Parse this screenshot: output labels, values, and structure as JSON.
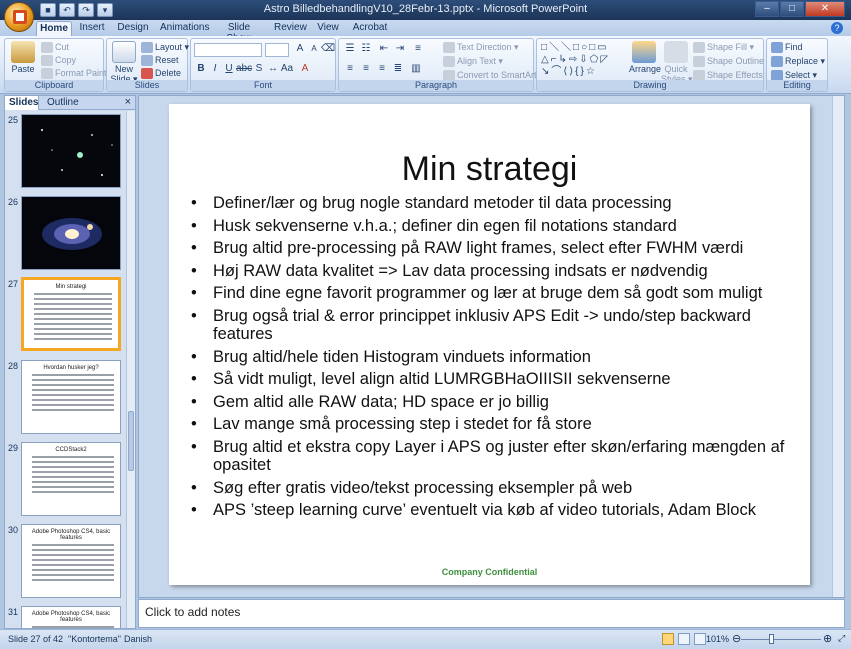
{
  "window": {
    "title": "Astro BilledbehandlingV10_28Febr-13.pptx - Microsoft PowerPoint"
  },
  "ribbon_tabs": [
    "Home",
    "Insert",
    "Design",
    "Animations",
    "Slide Show",
    "Review",
    "View",
    "Acrobat"
  ],
  "ribbon": {
    "clipboard": {
      "label": "Clipboard",
      "paste": "Paste",
      "cut": "Cut",
      "copy": "Copy",
      "format_painter": "Format Painter"
    },
    "slides": {
      "label": "Slides",
      "new_slide_1": "New",
      "new_slide_2": "Slide ▾",
      "layout": "Layout ▾",
      "reset": "Reset",
      "delete": "Delete"
    },
    "font": {
      "label": "Font"
    },
    "paragraph": {
      "label": "Paragraph",
      "text_direction": "Text Direction ▾",
      "align_text": "Align Text ▾",
      "convert_smartart": "Convert to SmartArt ▾"
    },
    "drawing": {
      "label": "Drawing",
      "arrange": "Arrange",
      "quick_styles_1": "Quick",
      "quick_styles_2": "Styles ▾",
      "shape_fill": "Shape Fill ▾",
      "shape_outline": "Shape Outline ▾",
      "shape_effects": "Shape Effects ▾"
    },
    "editing": {
      "label": "Editing",
      "find": "Find",
      "replace": "Replace ▾",
      "select": "Select ▾"
    }
  },
  "left_pane": {
    "tab_slides": "Slides",
    "tab_outline": "Outline",
    "thumbnails": [
      {
        "number": "25",
        "kind": "starfield"
      },
      {
        "number": "26",
        "kind": "galaxy"
      },
      {
        "number": "27",
        "title": "Min strategi",
        "selected": true
      },
      {
        "number": "28",
        "title": "Hvordan husker jeg?"
      },
      {
        "number": "29",
        "title": "CCDStack2"
      },
      {
        "number": "30",
        "title": "Adobe Photoshop CS4, basic features"
      },
      {
        "number": "31",
        "title": "Adobe Photoshop CS4, basic features"
      }
    ]
  },
  "slide": {
    "title": "Min strategi",
    "bullets": [
      "Definer/lær og brug nogle standard metoder til data processing",
      "Husk sekvenserne v.h.a.; definer din egen fil notations standard",
      "Brug altid pre-processing på RAW light frames, select efter FWHM værdi",
      "Høj RAW data kvalitet => Lav data processing indsats er nødvendig",
      "Find dine egne favorit programmer og lær at bruge dem så godt som muligt",
      "Brug også trial & error princippet inklusiv APS Edit -> undo/step backward features",
      "Brug altid/hele tiden Histogram vinduets information",
      "Så vidt muligt, level align altid LUMRGBHaOIIISII sekvenserne",
      "Gem altid alle RAW data; HD space er jo billig",
      "Lav mange små processing step i stedet for få store",
      "Brug altid et ekstra copy Layer i APS og juster efter skøn/erfaring mængden af opasitet",
      "Søg efter gratis video/tekst processing eksempler på web",
      "APS ’steep learning curve’ eventuelt via køb af video tutorials, Adam Block"
    ],
    "footer": "Company Confidential"
  },
  "notes": {
    "placeholder": "Click to add notes"
  },
  "status_bar": {
    "slide_count": "Slide 27 of 42",
    "theme": "\"Kontortema\"",
    "language": "Danish",
    "zoom": "101%"
  },
  "colors": {
    "accent": "#f5a623",
    "footer_green": "#3e8f3e",
    "chrome": "#afc5e0"
  }
}
